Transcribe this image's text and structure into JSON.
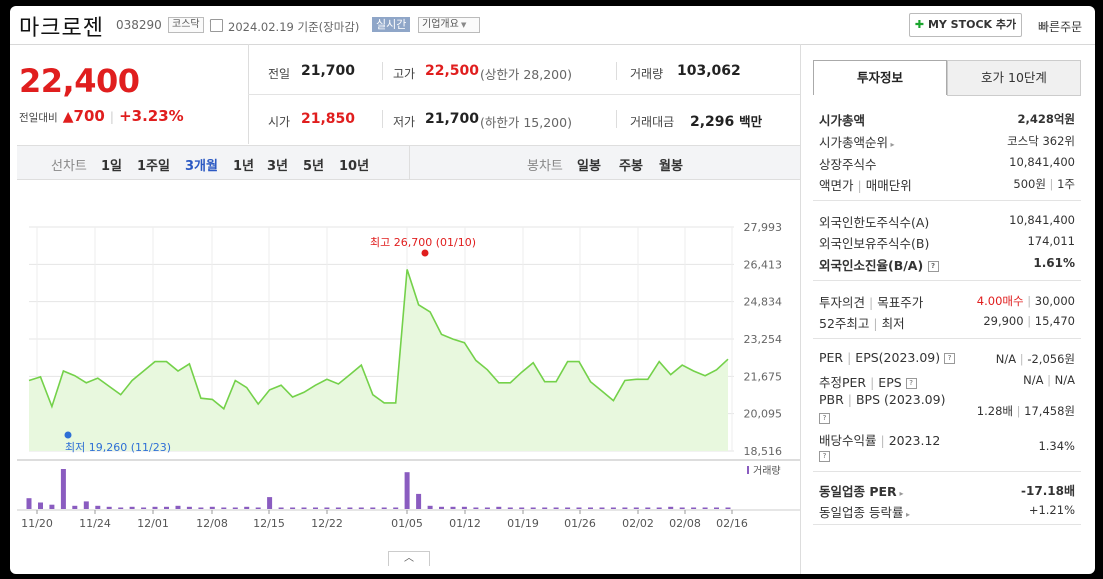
{
  "header": {
    "name": "마크로젠",
    "code": "038290",
    "market": "코스닥",
    "date": "2024.02.19",
    "basis": "기준(장마감)",
    "realtime": "실시간",
    "overview": "기업개요",
    "mystock": "MY STOCK 추가",
    "quick_order": "빠른주문"
  },
  "quote": {
    "price": "22,400",
    "change_label": "전일대비",
    "change": "700",
    "change_pct": "+3.23%",
    "prev_close_label": "전일",
    "prev_close": "21,700",
    "high_label": "고가",
    "high": "22,500",
    "upper_limit": "(상한가 28,200)",
    "volume_label": "거래량",
    "volume": "103,062",
    "open_label": "시가",
    "open": "21,850",
    "low_label": "저가",
    "low": "21,700",
    "lower_limit": "(하한가 15,200)",
    "amount_label": "거래대금",
    "amount": "2,296",
    "amount_unit": "백만"
  },
  "periods": {
    "line_label": "선차트",
    "items": [
      "1일",
      "1주일",
      "3개월",
      "1년",
      "3년",
      "5년",
      "10년"
    ],
    "active": "3개월",
    "candle_label": "봉차트",
    "candle_items": [
      "일봉",
      "주봉",
      "월봉"
    ]
  },
  "tabs": {
    "invest": "투자정보",
    "hoga": "호가 10단계"
  },
  "invest": {
    "market_cap_label": "시가총액",
    "market_cap": "2,428억원",
    "cap_rank_label": "시가총액순위",
    "cap_rank": "코스닥 362위",
    "shares_label": "상장주식수",
    "shares": "10,841,400",
    "par_label": "액면가",
    "unit_label": "매매단위",
    "par": "500원",
    "unit": "1주",
    "foreign_limit_label": "외국인한도주식수(A)",
    "foreign_limit": "10,841,400",
    "foreign_hold_label": "외국인보유주식수(B)",
    "foreign_hold": "174,011",
    "foreign_ratio_label": "외국인소진율(B/A)",
    "foreign_ratio": "1.61%",
    "opinion_label": "투자의견",
    "target_label": "목표주가",
    "opinion": "4.00매수",
    "target": "30,000",
    "w52_label": "52주최고",
    "w52_low_label": "최저",
    "w52_high": "29,900",
    "w52_low": "15,470",
    "per_label": "PER",
    "eps_label": "EPS(2023.09)",
    "per": "N/A",
    "eps": "-2,056원",
    "est_per_label": "추정PER",
    "est_eps_label": "EPS",
    "est_per": "N/A",
    "est_eps": "N/A",
    "pbr_label": "PBR",
    "bps_label": "BPS (2023.09)",
    "pbr": "1.28배",
    "bps": "17,458원",
    "div_label": "배당수익률",
    "div_year": "2023.12",
    "div": "1.34%",
    "ind_per_label": "동일업종 PER",
    "ind_per": "-17.18배",
    "ind_rate_label": "동일업종 등락률",
    "ind_rate": "+1.21%"
  },
  "chart_data": {
    "type": "area",
    "y_ticks": [
      "27,993",
      "26,413",
      "24,834",
      "23,254",
      "21,675",
      "20,095",
      "18,516"
    ],
    "ylim": [
      18516,
      27993
    ],
    "x_tick_labels": [
      "11/20",
      "11/24",
      "12/01",
      "12/08",
      "12/15",
      "12/22",
      "01/05",
      "01/12",
      "01/19",
      "01/26",
      "02/02",
      "02/08",
      "02/16"
    ],
    "high_annotation": "최고 26,700 (01/10)",
    "low_annotation": "최저 19,260 (11/23)",
    "volume_legend": "거래량",
    "price": [
      21500,
      21650,
      20400,
      21900,
      21700,
      21400,
      21600,
      21250,
      20900,
      21500,
      21900,
      22300,
      22300,
      21900,
      22200,
      20750,
      20700,
      20300,
      21500,
      21200,
      20500,
      21100,
      21300,
      20800,
      21000,
      21300,
      21550,
      21350,
      21750,
      22150,
      20900,
      20550,
      20550,
      26200,
      24700,
      24400,
      23450,
      23250,
      23100,
      22350,
      21950,
      21400,
      21400,
      21850,
      22250,
      21450,
      21450,
      22300,
      22300,
      21450,
      21050,
      20650,
      21500,
      21550,
      21550,
      22300,
      21750,
      22150,
      21900,
      21700,
      21950,
      22400
    ],
    "volume": [
      10,
      6,
      4,
      37,
      3,
      7,
      3,
      2,
      1,
      2,
      1,
      2,
      2,
      3,
      2,
      1,
      2,
      1,
      1,
      2,
      1,
      11,
      1,
      1,
      1,
      1,
      1,
      1,
      1,
      1,
      1,
      1,
      1,
      34,
      14,
      3,
      2,
      2,
      2,
      1,
      1,
      2,
      1,
      1,
      1,
      1,
      1,
      1,
      1,
      1,
      1,
      1,
      1,
      1,
      1,
      1,
      2,
      1,
      1,
      1,
      1,
      1
    ]
  }
}
